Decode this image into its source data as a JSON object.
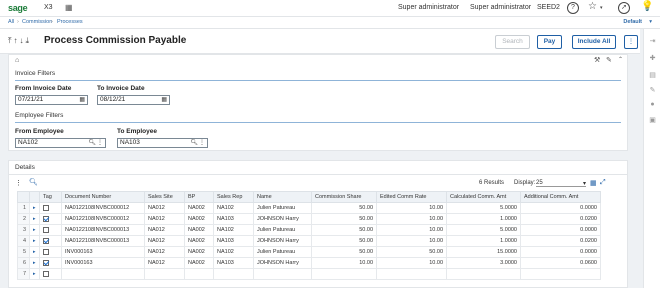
{
  "app": {
    "brand": "sage",
    "product": "X3",
    "user1": "Super administrator",
    "user2": "Super administrator",
    "folder": "SEED2",
    "default_label": "Default"
  },
  "breadcrumb": [
    "All",
    "Commission",
    "Processes"
  ],
  "title": "Process Commission Payable",
  "buttons": {
    "search": "Search",
    "pay": "Pay",
    "include_all": "Include All"
  },
  "invoice_filters": {
    "title": "Invoice Filters",
    "from_label": "From Invoice Date",
    "from_value": "07/21/21",
    "to_label": "To Invoice Date",
    "to_value": "08/12/21"
  },
  "employee_filters": {
    "title": "Employee Filters",
    "from_label": "From Employee",
    "from_value": "NA102",
    "to_label": "To Employee",
    "to_value": "NA103"
  },
  "details": {
    "title": "Details",
    "results": "6 Results",
    "display_label": "Display:",
    "display_value": "25",
    "columns": [
      "Tag",
      "Document Number",
      "Sales Site",
      "BP",
      "Sales Rep",
      "Name",
      "Commission Share",
      "Edited Comm Rate",
      "Calculated Comm. Amt",
      "Additional Comm. Amt"
    ],
    "rows": [
      {
        "n": "1",
        "tag": false,
        "doc": "NA0122108INVBC000012",
        "site": "NA012",
        "bp": "NA002",
        "rep": "NA102",
        "name": "Julien Patureau",
        "share": "50.00",
        "rate": "10.00",
        "calc": "5.0000",
        "add": "0.0000"
      },
      {
        "n": "2",
        "tag": true,
        "doc": "NA0122108INVBC000012",
        "site": "NA012",
        "bp": "NA002",
        "rep": "NA103",
        "name": "JOHNSON Harry",
        "share": "50.00",
        "rate": "10.00",
        "calc": "1.0000",
        "add": "0.0200"
      },
      {
        "n": "3",
        "tag": false,
        "doc": "NA0122108INVBC000013",
        "site": "NA012",
        "bp": "NA002",
        "rep": "NA102",
        "name": "Julien Patureau",
        "share": "50.00",
        "rate": "10.00",
        "calc": "5.0000",
        "add": "0.0000"
      },
      {
        "n": "4",
        "tag": true,
        "doc": "NA0122108INVBC000013",
        "site": "NA012",
        "bp": "NA002",
        "rep": "NA103",
        "name": "JOHNSON Harry",
        "share": "50.00",
        "rate": "10.00",
        "calc": "1.0000",
        "add": "0.0200"
      },
      {
        "n": "5",
        "tag": false,
        "doc": "INV000163",
        "site": "NA012",
        "bp": "NA002",
        "rep": "NA102",
        "name": "Julien Patureau",
        "share": "50.00",
        "rate": "50.00",
        "calc": "15.0000",
        "add": "0.0000"
      },
      {
        "n": "6",
        "tag": true,
        "doc": "INV000163",
        "site": "NA012",
        "bp": "NA002",
        "rep": "NA103",
        "name": "JOHNSON Harry",
        "share": "10.00",
        "rate": "10.00",
        "calc": "3.0000",
        "add": "0.0600"
      },
      {
        "n": "7",
        "tag": false,
        "doc": "",
        "site": "",
        "bp": "",
        "rep": "",
        "name": "",
        "share": "",
        "rate": "",
        "calc": "",
        "add": ""
      }
    ]
  }
}
